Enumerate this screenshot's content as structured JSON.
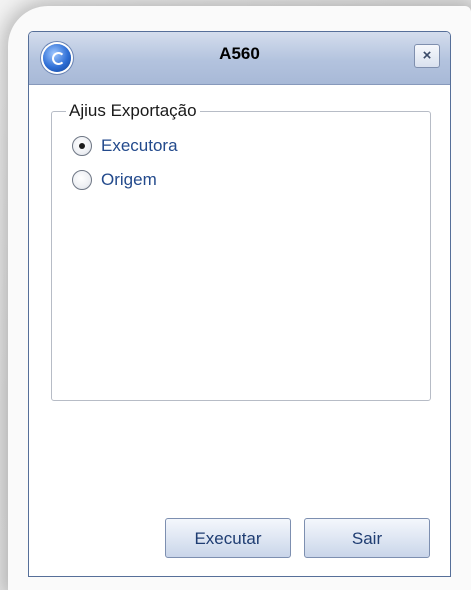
{
  "window": {
    "title": "A560",
    "close_label": "×"
  },
  "group": {
    "legend": "Ajius Exportação",
    "options": [
      {
        "label": "Executora",
        "selected": true
      },
      {
        "label": "Origem",
        "selected": false
      }
    ]
  },
  "buttons": {
    "execute_label": "Executar",
    "exit_label": "Sair"
  },
  "icons": {
    "app": "app-globe-icon",
    "close": "close-icon"
  }
}
